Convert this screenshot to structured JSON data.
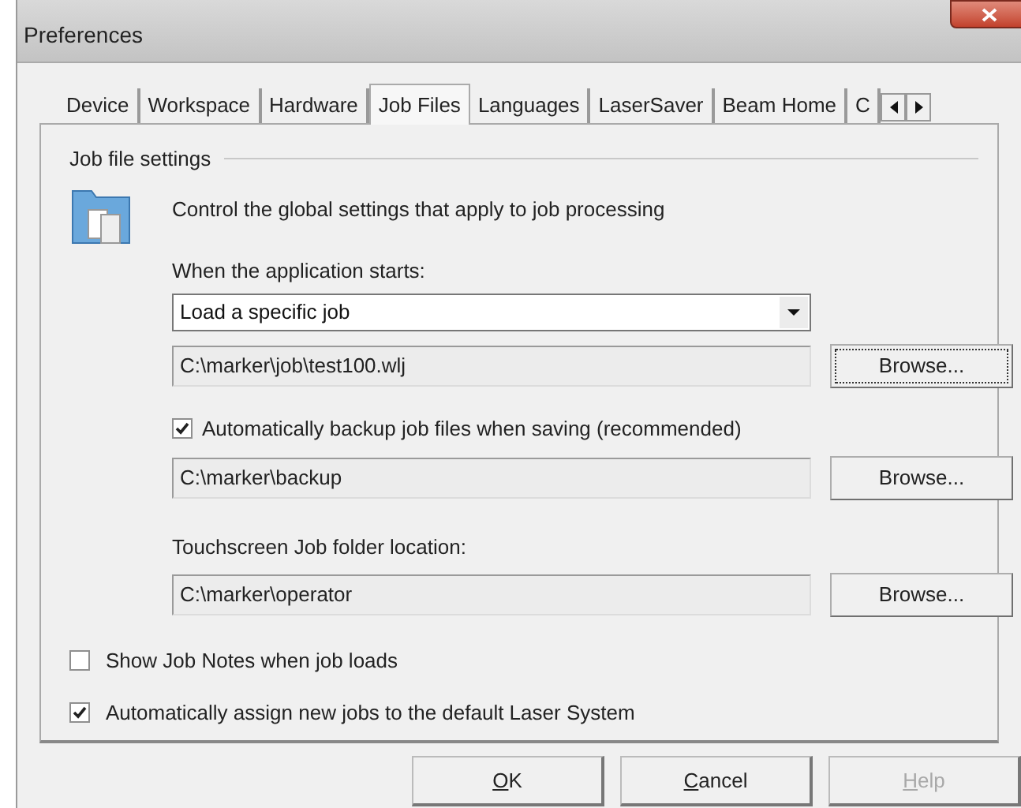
{
  "window": {
    "title": "Preferences"
  },
  "tabs": [
    {
      "label": "Device",
      "selected": false
    },
    {
      "label": "Workspace",
      "selected": false
    },
    {
      "label": "Hardware",
      "selected": false
    },
    {
      "label": "Job Files",
      "selected": true
    },
    {
      "label": "Languages",
      "selected": false
    },
    {
      "label": "LaserSaver",
      "selected": false
    },
    {
      "label": "Beam Home",
      "selected": false
    },
    {
      "label": "C",
      "selected": false
    }
  ],
  "group": {
    "title": "Job file settings",
    "description": "Control the global settings that apply to job processing"
  },
  "startup": {
    "label": "When the application starts:",
    "value": "Load a specific job",
    "path": "C:\\marker\\job\\test100.wlj",
    "browse": {
      "label": "Browse...",
      "focused": true
    }
  },
  "backup": {
    "label": "Automatically backup job files when saving  (recommended)",
    "checked": true,
    "path": "C:\\marker\\backup",
    "browse": {
      "label": "Browse...",
      "focused": false
    }
  },
  "touchscreen": {
    "label": "Touchscreen Job folder location:",
    "path": "C:\\marker\\operator",
    "browse": {
      "label": "Browse...",
      "focused": false
    }
  },
  "options": [
    {
      "label": "Show Job Notes when job loads",
      "checked": false
    },
    {
      "label": "Automatically assign new jobs to the default Laser System",
      "checked": true
    }
  ],
  "buttons": [
    {
      "mnemonic": "O",
      "rest": "K",
      "disabled": false
    },
    {
      "mnemonic": "C",
      "rest": "ancel",
      "disabled": false
    },
    {
      "mnemonic": "H",
      "rest": "elp",
      "disabled": true
    }
  ]
}
